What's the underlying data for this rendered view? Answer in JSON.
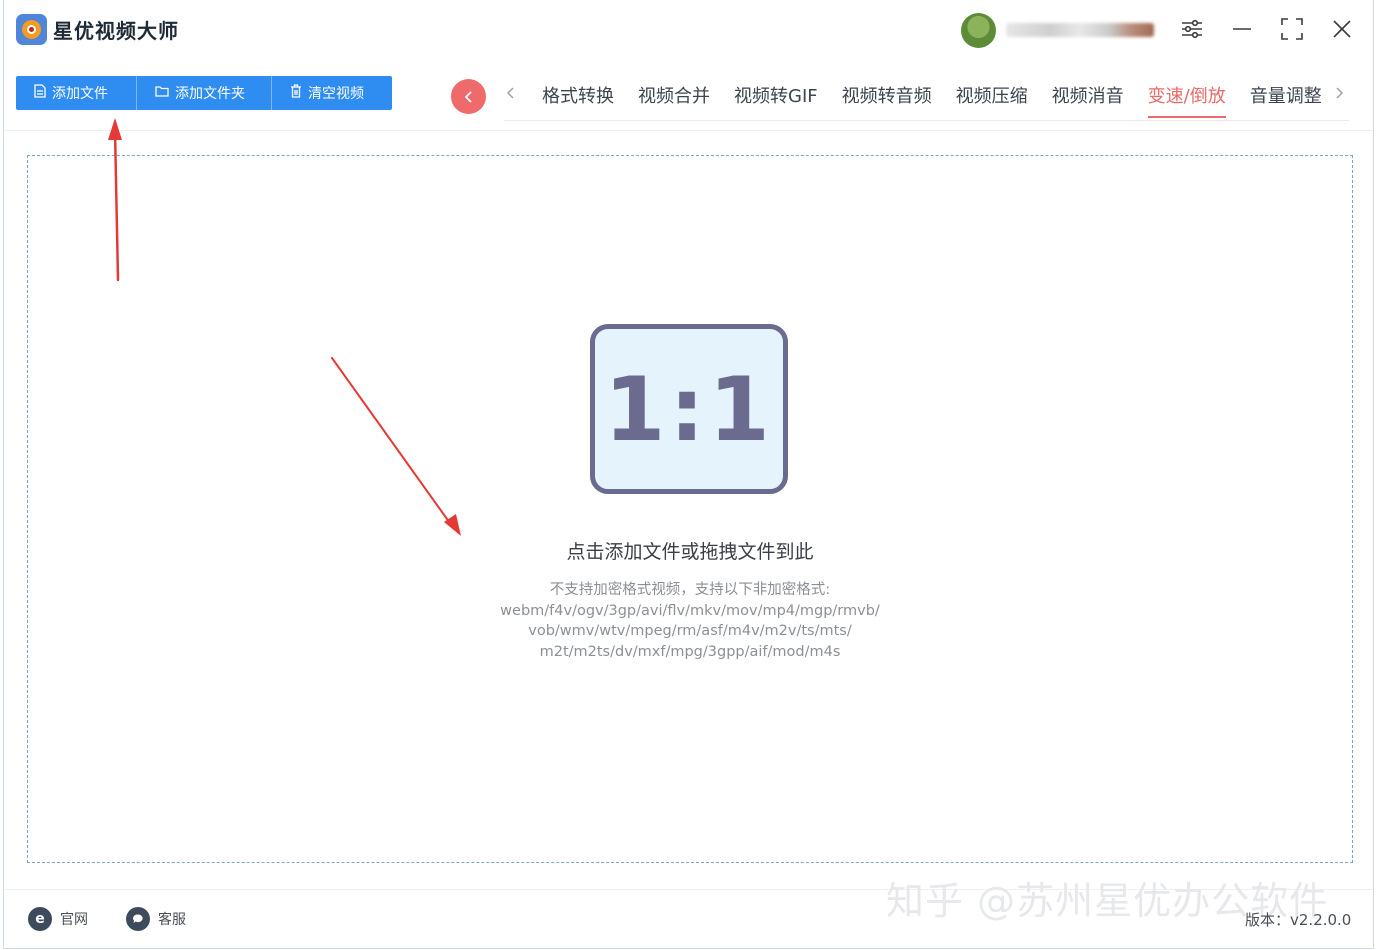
{
  "app": {
    "title": "星优视频大师"
  },
  "toolbar": {
    "add_file": "添加文件",
    "add_folder": "添加文件夹",
    "clear_videos": "清空视频"
  },
  "tabs": [
    {
      "label": "格式转换"
    },
    {
      "label": "视频合并"
    },
    {
      "label": "视频转GIF"
    },
    {
      "label": "视频转音频"
    },
    {
      "label": "视频压缩"
    },
    {
      "label": "视频消音"
    },
    {
      "label": "变速/倒放",
      "active": true
    },
    {
      "label": "音量调整"
    }
  ],
  "dropzone": {
    "icon_text": "1:1",
    "title": "点击添加文件或拖拽文件到此",
    "formats_line1": "不支持加密格式视频，支持以下非加密格式:",
    "formats_line2": "webm/f4v/ogv/3gp/avi/flv/mkv/mov/mp4/mgp/rmvb/",
    "formats_line3": "vob/wmv/wtv/mpeg/rm/asf/m4v/m2v/ts/mts/",
    "formats_line4": "m2t/m2ts/dv/mxf/mpg/3gpp/aif/mod/m4s"
  },
  "footer": {
    "website": "官网",
    "support": "客服",
    "version": "版本：v2.2.0.0"
  },
  "watermark": "知乎 @苏州星优办公软件",
  "colors": {
    "primary": "#2f8cf0",
    "active_tab": "#e86a6a",
    "collapse_button": "#ef6b6b",
    "annotation_arrow": "#e53935"
  },
  "icons": [
    "app-logo-icon",
    "avatar",
    "settings-sliders-icon",
    "minimize-icon",
    "maximize-icon",
    "close-icon",
    "file-icon",
    "folder-icon",
    "trash-icon",
    "chevron-left-icon",
    "chevron-right-icon",
    "aspect-ratio-icon",
    "browser-e-icon",
    "chat-bubble-icon"
  ]
}
